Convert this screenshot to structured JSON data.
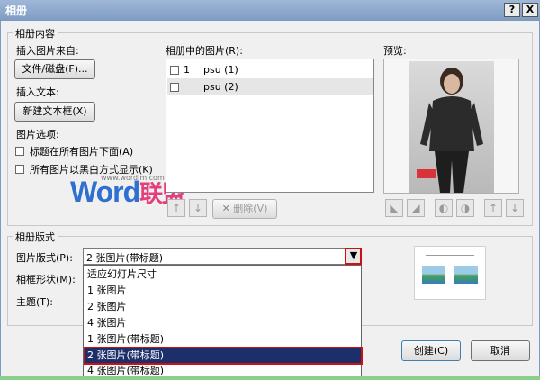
{
  "window": {
    "title": "相册",
    "help_label": "?",
    "close_label": "X"
  },
  "album_content": {
    "legend": "相册内容",
    "insert_from_label": "插入图片来自:",
    "file_disk_button": "文件/磁盘(F)...",
    "insert_text_label": "插入文本:",
    "new_textbox_button": "新建文本框(X)",
    "picture_options_label": "图片选项:",
    "caption_below_label": "标题在所有图片下面(A)",
    "all_bw_label": "所有图片以黑白方式显示(K)",
    "pictures_in_album_label": "相册中的图片(R):",
    "pictures": [
      {
        "index": "1",
        "name": "psu (1)",
        "selected": false
      },
      {
        "index": "",
        "name": "psu (2)",
        "selected": true
      }
    ],
    "up_arrow": "↑",
    "down_arrow": "↓",
    "delete_button": "删除(V)",
    "preview_label": "预览:"
  },
  "watermark": {
    "main": "Word",
    "cn": "联盟",
    "url": "www.wordlm.com"
  },
  "album_layout": {
    "legend": "相册版式",
    "picture_layout_label": "图片版式(P):",
    "picture_layout_value": "2 张图片(带标题)",
    "frame_shape_label": "相框形状(M):",
    "theme_label": "主题(T):",
    "options": [
      "适应幻灯片尺寸",
      "1 张图片",
      "2 张图片",
      "4 张图片",
      "1 张图片(带标题)",
      "2 张图片(带标题)",
      "4 张图片(带标题)"
    ],
    "selected_index": 5
  },
  "buttons": {
    "create": "创建(C)",
    "cancel": "取消"
  }
}
